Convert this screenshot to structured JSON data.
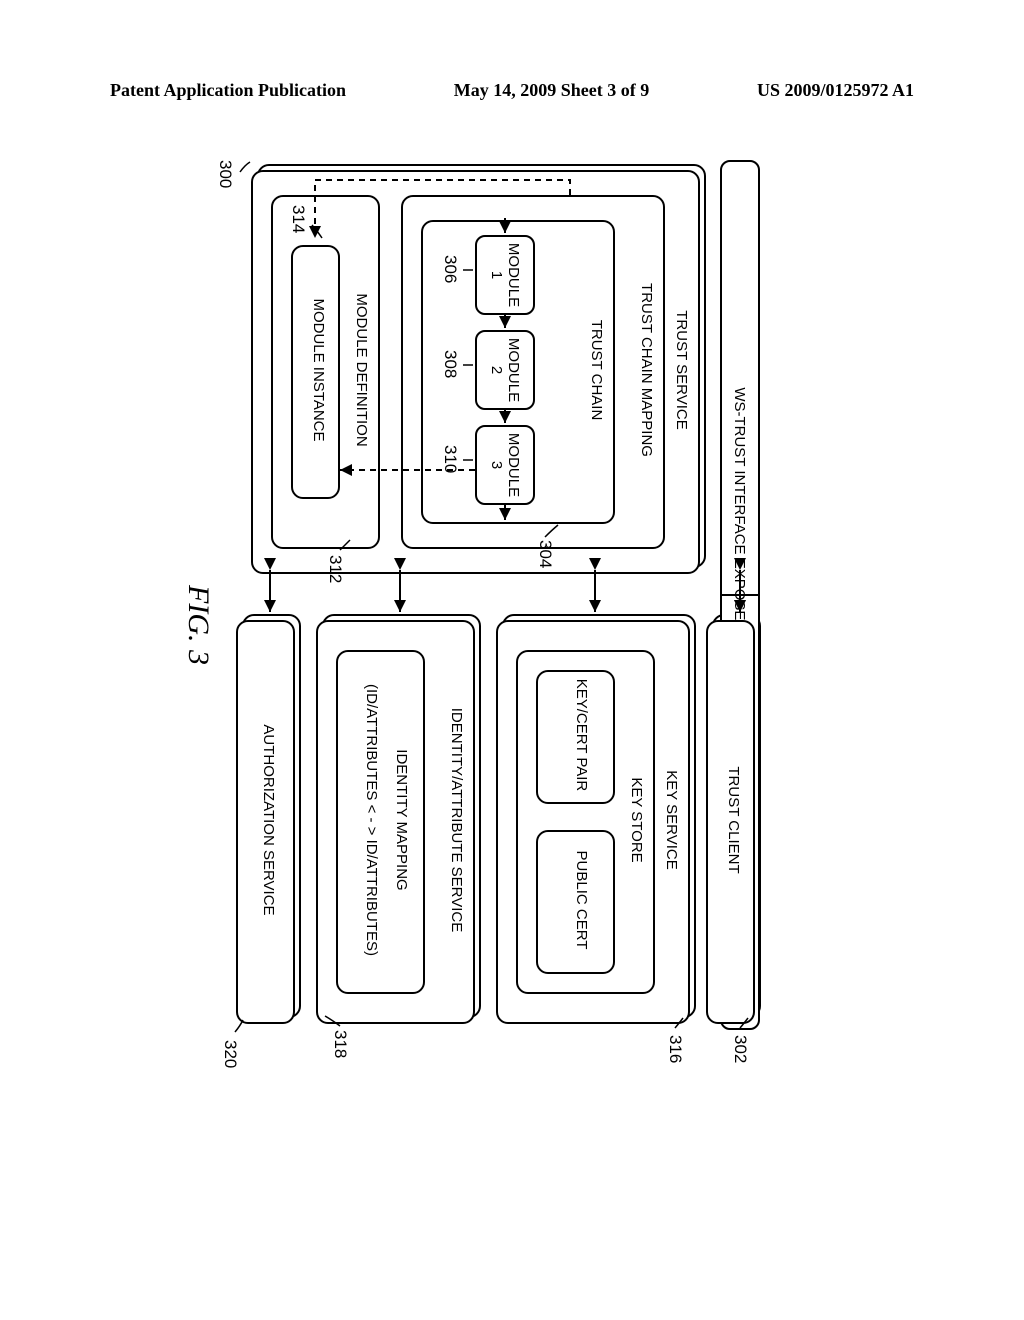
{
  "header": {
    "left": "Patent Application Publication",
    "center": "May 14, 2009  Sheet 3 of 9",
    "right": "US 2009/0125972 A1"
  },
  "blocks": {
    "ws_trust_interface": "WS-TRUST INTERFACE EXPOSED AS WSDL AND JAVA API",
    "trust_client": "TRUST CLIENT",
    "trust_service": "TRUST SERVICE",
    "trust_chain_mapping": "TRUST CHAIN MAPPING",
    "trust_chain": "TRUST CHAIN",
    "module1": "MODULE 1",
    "module2": "MODULE 2",
    "module3": "MODULE 3",
    "module_definition": "MODULE DEFINITION",
    "module_instance": "MODULE INSTANCE",
    "key_service": "KEY SERVICE",
    "key_store": "KEY STORE",
    "keycert_pair": "KEY/CERT PAIR",
    "public_cert": "PUBLIC CERT",
    "identity_service": "IDENTITY/ATTRIBUTE SERVICE",
    "identity_mapping_l1": "IDENTITY MAPPING",
    "identity_mapping_l2": "(ID/ATTRIBUTES < - > ID/ATTRIBUTES)",
    "auth_service": "AUTHORIZATION SERVICE"
  },
  "refs": {
    "r300": "300",
    "r302": "302",
    "r304": "304",
    "r306": "306",
    "r308": "308",
    "r310": "310",
    "r312": "312",
    "r314": "314",
    "r316": "316",
    "r318": "318",
    "r320": "320"
  },
  "figure_caption": "FIG. 3"
}
